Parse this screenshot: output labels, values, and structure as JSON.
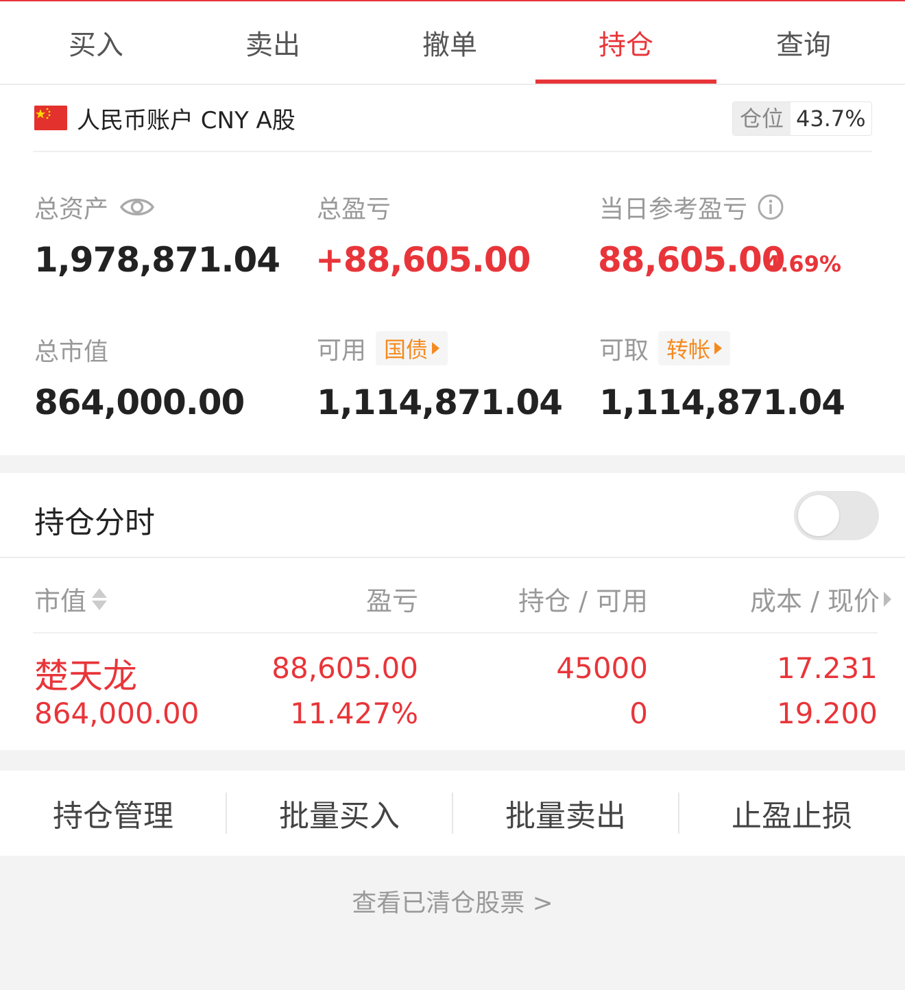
{
  "tabs": [
    {
      "label": "买入"
    },
    {
      "label": "卖出"
    },
    {
      "label": "撤单"
    },
    {
      "label": "持仓",
      "active": true
    },
    {
      "label": "查询"
    }
  ],
  "account": {
    "title": "人民币账户 CNY A股",
    "position_label": "仓位",
    "position_value": "43.7%",
    "stats": {
      "total_assets": {
        "label": "总资产",
        "value": "1,978,871.04"
      },
      "total_pnl": {
        "label": "总盈亏",
        "value": "+88,605.00"
      },
      "daily_pnl": {
        "label": "当日参考盈亏",
        "value": "88,605.00",
        "percent": "4.69%"
      },
      "market_value": {
        "label": "总市值",
        "value": "864,000.00"
      },
      "available": {
        "label": "可用",
        "tag": "国债",
        "value": "1,114,871.04"
      },
      "withdrawable": {
        "label": "可取",
        "tag": "转帐",
        "value": "1,114,871.04"
      }
    }
  },
  "holdings": {
    "title": "持仓分时",
    "toggle_on": false,
    "columns": [
      "市值",
      "盈亏",
      "持仓 / 可用",
      "成本 / 现价"
    ],
    "rows": [
      {
        "name": "楚天龙",
        "market_value": "864,000.00",
        "pnl": "88,605.00",
        "pnl_pct": "11.427%",
        "holding": "45000",
        "available": "0",
        "cost": "17.231",
        "price": "19.200"
      }
    ]
  },
  "actions": [
    "持仓管理",
    "批量买入",
    "批量卖出",
    "止盈止损"
  ],
  "cleared_link": "查看已清仓股票 >",
  "colors": {
    "accent": "#e8353a",
    "tag": "#f58a1f"
  }
}
